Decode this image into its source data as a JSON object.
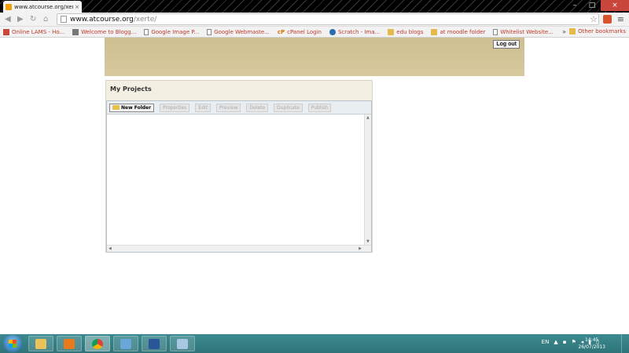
{
  "browser": {
    "tab_title": "www.atcourse.org/xerte/",
    "tab_close": "×",
    "url_host": "www.atcourse.org",
    "url_path": "/xerte/",
    "star": "☆",
    "menu": "≡",
    "window": {
      "minimize": "–",
      "maximize": "□",
      "close": "×"
    }
  },
  "bookmarks": {
    "items": [
      {
        "label": "Online LAMS - Ho...",
        "icon": "red"
      },
      {
        "label": "Welcome to Blogg...",
        "icon": "gray"
      },
      {
        "label": "Google Image P...",
        "icon": "page"
      },
      {
        "label": "Google Webmaste...",
        "icon": "page"
      },
      {
        "label": "cPanel Login",
        "icon": "cp"
      },
      {
        "label": "Scratch - Ima...",
        "icon": "blue"
      },
      {
        "label": "edu blogs",
        "icon": "folder"
      },
      {
        "label": "at moodle folder",
        "icon": "folder"
      },
      {
        "label": "Whitelist Website...",
        "icon": "page"
      }
    ],
    "more": "»",
    "other_label": "Other bookmarks"
  },
  "page": {
    "logout_label": "Log out",
    "projects_title": "My Projects",
    "toolbar": {
      "new_folder": "New Folder",
      "properties": "Properties",
      "edit": "Edit",
      "preview": "Preview",
      "delete": "Delete",
      "duplicate": "Duplicate",
      "publish": "Publish"
    }
  },
  "taskbar": {
    "language": "EN",
    "time": "14:45",
    "date": "26/07/2013"
  },
  "colors": {
    "header_band": "#d7c99d",
    "panel_bg": "#f3efe3",
    "taskbar": "#3b8a8f"
  }
}
